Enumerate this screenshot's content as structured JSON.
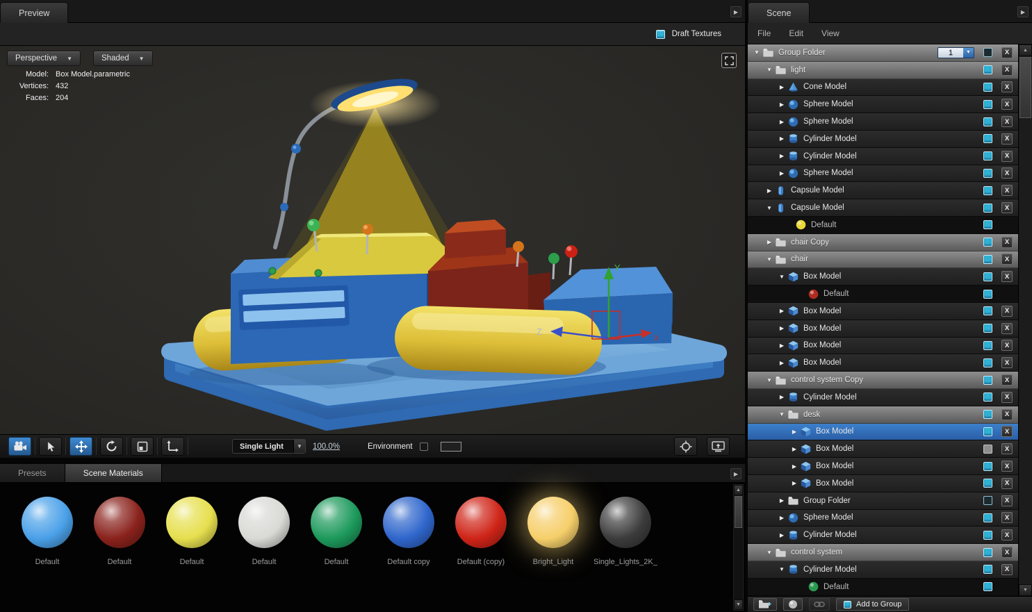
{
  "icons": {
    "expanded": "▼",
    "collapsed": "▶",
    "caret_down": "▼",
    "panel_expand": "▶",
    "scroll_up": "▲",
    "scroll_down": "▼"
  },
  "preview": {
    "tab": "Preview",
    "draft_textures": "Draft Textures",
    "camera_mode": "Perspective",
    "shading_mode": "Shaded",
    "model_info": [
      {
        "label": "Model:",
        "value": "Box Model.parametric"
      },
      {
        "label": "Vertices:",
        "value": "432"
      },
      {
        "label": "Faces:",
        "value": "204"
      }
    ],
    "axis_labels": {
      "x": "X",
      "y": "Y",
      "z": "Z"
    },
    "toolbar": {
      "buttons": [
        {
          "name": "camera",
          "active": true
        },
        {
          "name": "select",
          "active": false
        },
        {
          "name": "move",
          "active": true
        },
        {
          "name": "rotate",
          "active": false
        },
        {
          "name": "frame",
          "active": false
        },
        {
          "name": "transform",
          "active": false
        }
      ],
      "light_mode": "Single Light",
      "zoom": "100.0%",
      "environment_label": "Environment"
    }
  },
  "materials_panel": {
    "tabs": [
      {
        "label": "Presets",
        "active": false
      },
      {
        "label": "Scene Materials",
        "active": true
      }
    ],
    "materials": [
      {
        "name": "Default",
        "color": "#4aa0e8"
      },
      {
        "name": "Default",
        "color": "#8a221c"
      },
      {
        "name": "Default",
        "color": "#e6df4e"
      },
      {
        "name": "Default",
        "color": "#d9d9d5"
      },
      {
        "name": "Default",
        "color": "#1d9a5c"
      },
      {
        "name": "Default copy",
        "color": "#2f66cc"
      },
      {
        "name": "Default (copy)",
        "color": "#cf2418"
      },
      {
        "name": "Bright_Light",
        "color": "#f6cf6a",
        "glow": true
      },
      {
        "name": "Single_Lights_2K_",
        "color": "#3c3c3c"
      }
    ]
  },
  "scene": {
    "tab": "Scene",
    "menu": [
      "File",
      "Edit",
      "View"
    ],
    "delete_glyph": "X",
    "add_to_group": "Add to Group",
    "tree": [
      {
        "label": "Group Folder",
        "indent": 0,
        "arrow": "down",
        "icon": "folder",
        "style": "header",
        "check": "outline",
        "x": true,
        "counter": "1"
      },
      {
        "label": "light",
        "indent": 1,
        "arrow": "down",
        "icon": "folder",
        "style": "group",
        "check": "on",
        "x": true
      },
      {
        "label": "Cone Model",
        "indent": 2,
        "arrow": "right",
        "icon": "cone",
        "style": "item",
        "check": "on",
        "x": true
      },
      {
        "label": "Sphere Model",
        "indent": 2,
        "arrow": "right",
        "icon": "sphere",
        "style": "item",
        "check": "on",
        "x": true
      },
      {
        "label": "Sphere Model",
        "indent": 2,
        "arrow": "right",
        "icon": "sphere",
        "style": "item",
        "check": "on",
        "x": true
      },
      {
        "label": "Cylinder Model",
        "indent": 2,
        "arrow": "right",
        "icon": "cylinder",
        "style": "item",
        "check": "on",
        "x": true
      },
      {
        "label": "Cylinder Model",
        "indent": 2,
        "arrow": "right",
        "icon": "cylinder",
        "style": "item",
        "check": "on",
        "x": true
      },
      {
        "label": "Sphere Model",
        "indent": 2,
        "arrow": "right",
        "icon": "sphere",
        "style": "item",
        "check": "on",
        "x": true
      },
      {
        "label": "Capsule Model",
        "indent": 1,
        "arrow": "right",
        "icon": "capsule",
        "style": "item",
        "check": "on",
        "x": true
      },
      {
        "label": "Capsule Model",
        "indent": 1,
        "arrow": "down",
        "icon": "capsule",
        "style": "item",
        "check": "on",
        "x": true
      },
      {
        "label": "Default",
        "indent": 2,
        "arrow": "none",
        "icon": "material",
        "color": "#e8d83a",
        "style": "material",
        "check": "on",
        "x": false
      },
      {
        "label": "chair Copy",
        "indent": 1,
        "arrow": "right",
        "icon": "folder",
        "style": "group",
        "check": "on",
        "x": true
      },
      {
        "label": "chair",
        "indent": 1,
        "arrow": "down",
        "icon": "folder",
        "style": "group",
        "check": "on",
        "x": true
      },
      {
        "label": "Box Model",
        "indent": 2,
        "arrow": "down",
        "icon": "box",
        "style": "item",
        "check": "on",
        "x": true
      },
      {
        "label": "Default",
        "indent": 3,
        "arrow": "none",
        "icon": "material",
        "color": "#b02c20",
        "style": "material",
        "check": "on",
        "x": false
      },
      {
        "label": "Box Model",
        "indent": 2,
        "arrow": "right",
        "icon": "box",
        "style": "item",
        "check": "on",
        "x": true
      },
      {
        "label": "Box Model",
        "indent": 2,
        "arrow": "right",
        "icon": "box",
        "style": "item",
        "check": "on",
        "x": true
      },
      {
        "label": "Box Model",
        "indent": 2,
        "arrow": "right",
        "icon": "box",
        "style": "item",
        "check": "on",
        "x": true
      },
      {
        "label": "Box Model",
        "indent": 2,
        "arrow": "right",
        "icon": "box",
        "style": "item",
        "check": "on",
        "x": true
      },
      {
        "label": "control system Copy",
        "indent": 1,
        "arrow": "down",
        "icon": "folder",
        "style": "group",
        "check": "on",
        "x": true
      },
      {
        "label": "Cylinder Model",
        "indent": 2,
        "arrow": "right",
        "icon": "cylinder",
        "style": "item",
        "check": "on",
        "x": true
      },
      {
        "label": "desk",
        "indent": 2,
        "arrow": "down",
        "icon": "folder",
        "style": "group",
        "check": "on",
        "x": true
      },
      {
        "label": "Box Model",
        "indent": 3,
        "arrow": "right",
        "icon": "box",
        "style": "selected",
        "check": "on",
        "x": true
      },
      {
        "label": "Box Model",
        "indent": 3,
        "arrow": "right",
        "icon": "box",
        "style": "item",
        "check": "dim",
        "x": true
      },
      {
        "label": "Box Model",
        "indent": 3,
        "arrow": "right",
        "icon": "box",
        "style": "item",
        "check": "on",
        "x": true
      },
      {
        "label": "Box Model",
        "indent": 3,
        "arrow": "right",
        "icon": "box",
        "style": "item",
        "check": "on",
        "x": true
      },
      {
        "label": "Group Folder",
        "indent": 2,
        "arrow": "right",
        "icon": "folder",
        "style": "item",
        "check": "outline",
        "x": true
      },
      {
        "label": "Sphere Model",
        "indent": 2,
        "arrow": "right",
        "icon": "sphere",
        "style": "item",
        "check": "on",
        "x": true
      },
      {
        "label": "Cylinder Model",
        "indent": 2,
        "arrow": "right",
        "icon": "cylinder",
        "style": "item",
        "check": "on",
        "x": true
      },
      {
        "label": "control system",
        "indent": 1,
        "arrow": "down",
        "icon": "folder",
        "style": "group",
        "check": "on",
        "x": true
      },
      {
        "label": "Cylinder Model",
        "indent": 2,
        "arrow": "down",
        "icon": "cylinder",
        "style": "item",
        "check": "on",
        "x": true
      },
      {
        "label": "Default",
        "indent": 3,
        "arrow": "none",
        "icon": "material",
        "color": "#2a9a50",
        "style": "material",
        "check": "on",
        "x": false
      }
    ]
  }
}
